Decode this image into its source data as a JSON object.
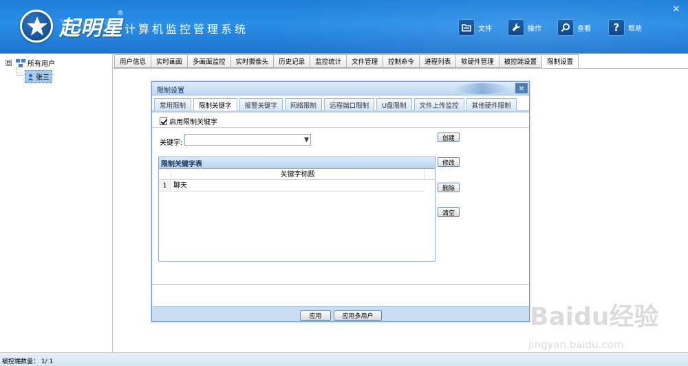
{
  "header": {
    "brand": "起明星",
    "registered": "®",
    "subtitle": "计算机监控管理系统",
    "close": "×",
    "toolbar": [
      {
        "label": "文件",
        "icon": "folder-icon"
      },
      {
        "label": "操作",
        "icon": "wrench-icon"
      },
      {
        "label": "查看",
        "icon": "magnifier-icon"
      },
      {
        "label": "帮助",
        "icon": "help-icon"
      }
    ]
  },
  "tree": {
    "expander": "⊟",
    "root_label": "所有用户",
    "child_label": "张三"
  },
  "main_tabs": [
    "用户信息",
    "实时画面",
    "多画面监控",
    "实时摄像头",
    "历史记录",
    "监控统计",
    "文件管理",
    "控制命令",
    "进程列表",
    "软硬件管理",
    "被控端设置",
    "限制设置"
  ],
  "main_tab_active": 11,
  "dialog": {
    "title": "限制设置",
    "close": "×",
    "tabs": [
      "常用限制",
      "限制关键字",
      "报警关键字",
      "网络限制",
      "远程端口限制",
      "U盘限制",
      "文件上传监控",
      "其他硬件限制"
    ],
    "tab_active": 1,
    "checkbox_label": "启用限制关键字",
    "checkbox_checked": true,
    "keyword_label": "关键字:",
    "keyword_value": "",
    "grid_title": "限制关键字表",
    "grid_column": "关键字标题",
    "rows": [
      {
        "num": "1",
        "value": "聊天"
      }
    ],
    "buttons": {
      "create": "创建",
      "modify": "修改",
      "delete": "删除",
      "clear": "清空"
    },
    "footer": {
      "apply": "应用",
      "apply_multi": "应用多用户"
    }
  },
  "status": {
    "text": "被控端数量： 1/ 1"
  },
  "watermark": {
    "main": "Baidu经验",
    "sub": "jingyan.baidu.com"
  }
}
